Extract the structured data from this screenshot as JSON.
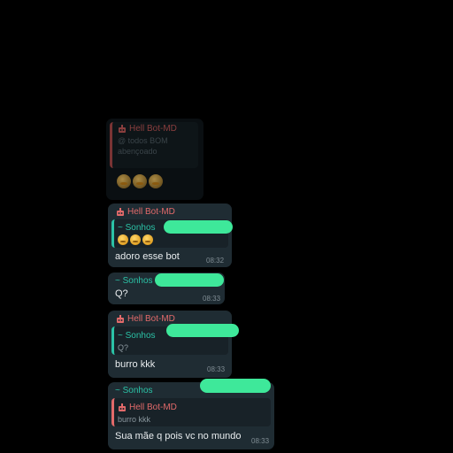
{
  "colors": {
    "background": "#000000",
    "bubble": "#1f2c33",
    "bot_name": "#e26a6a",
    "user_name": "#2bc2a6",
    "redaction": "#3ee89a"
  },
  "messages": {
    "m0": {
      "sender": "Hell Bot-MD",
      "quote_line1": "@ todos BOM",
      "quote_line2": "abençoado",
      "emoji": "emoji-row"
    },
    "m1": {
      "sender": "Hell Bot-MD",
      "quote_sender": "~ Sonhos",
      "quote_emoji": "emoji-row",
      "text": "adoro esse bot",
      "time": "08:32"
    },
    "m2": {
      "sender": "~ Sonhos",
      "text": "Q?",
      "time": "08:33"
    },
    "m3": {
      "sender": "Hell Bot-MD",
      "quote_sender": "~ Sonhos",
      "quote_text": "Q?",
      "text": "burro kkk",
      "time": "08:33"
    },
    "m4": {
      "sender": "~ Sonhos",
      "quote_sender": "Hell Bot-MD",
      "quote_text": "burro kkk",
      "text": "Sua mãe q pois vc no mundo",
      "time": "08:33"
    }
  }
}
